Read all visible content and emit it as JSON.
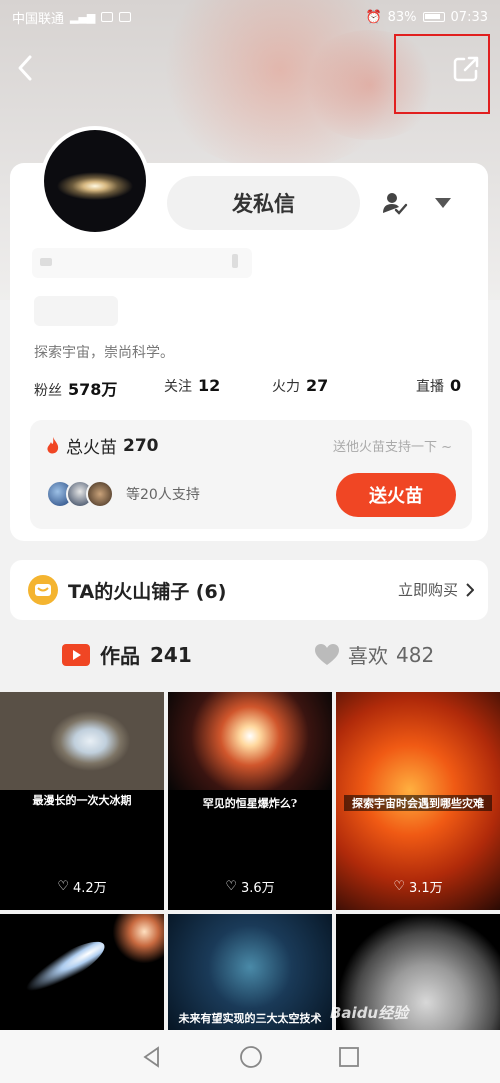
{
  "status_bar": {
    "carrier": "中国联通",
    "battery": "83%",
    "time": "07:33"
  },
  "profile": {
    "dm_button": "发私信",
    "bio": "探索宇宙，崇尚科学。",
    "stats": [
      {
        "label": "粉丝",
        "value": "578万"
      },
      {
        "label": "关注",
        "value": "12"
      },
      {
        "label": "火力",
        "value": "27"
      },
      {
        "label": "直播",
        "value": "0"
      }
    ]
  },
  "fire": {
    "label": "总火苗",
    "count": "270",
    "hint": "送他火苗支持一下 ~",
    "supporters_text": "等20人支持",
    "send_button": "送火苗"
  },
  "shop": {
    "title": "TA的火山铺子 (6)",
    "buy_label": "立即购买"
  },
  "tabs": {
    "works_label": "作品",
    "works_count": "241",
    "likes_label": "喜欢",
    "likes_count": "482"
  },
  "videos": [
    {
      "caption": "最漫长的一次大冰期",
      "likes": "4.2万"
    },
    {
      "caption": "罕见的恒星爆炸么?",
      "likes": "3.6万"
    },
    {
      "caption": "探索宇宙时会遇到哪些灾难",
      "likes": "3.1万"
    },
    {
      "caption": "",
      "likes": ""
    },
    {
      "caption": "未来有望实现的三大太空技术",
      "likes": ""
    },
    {
      "caption": "",
      "likes": ""
    }
  ],
  "watermark": "Baidu经验",
  "colors": {
    "accent": "#f04624",
    "highlight_box": "#e11f1f",
    "shop_icon": "#f4b430"
  }
}
